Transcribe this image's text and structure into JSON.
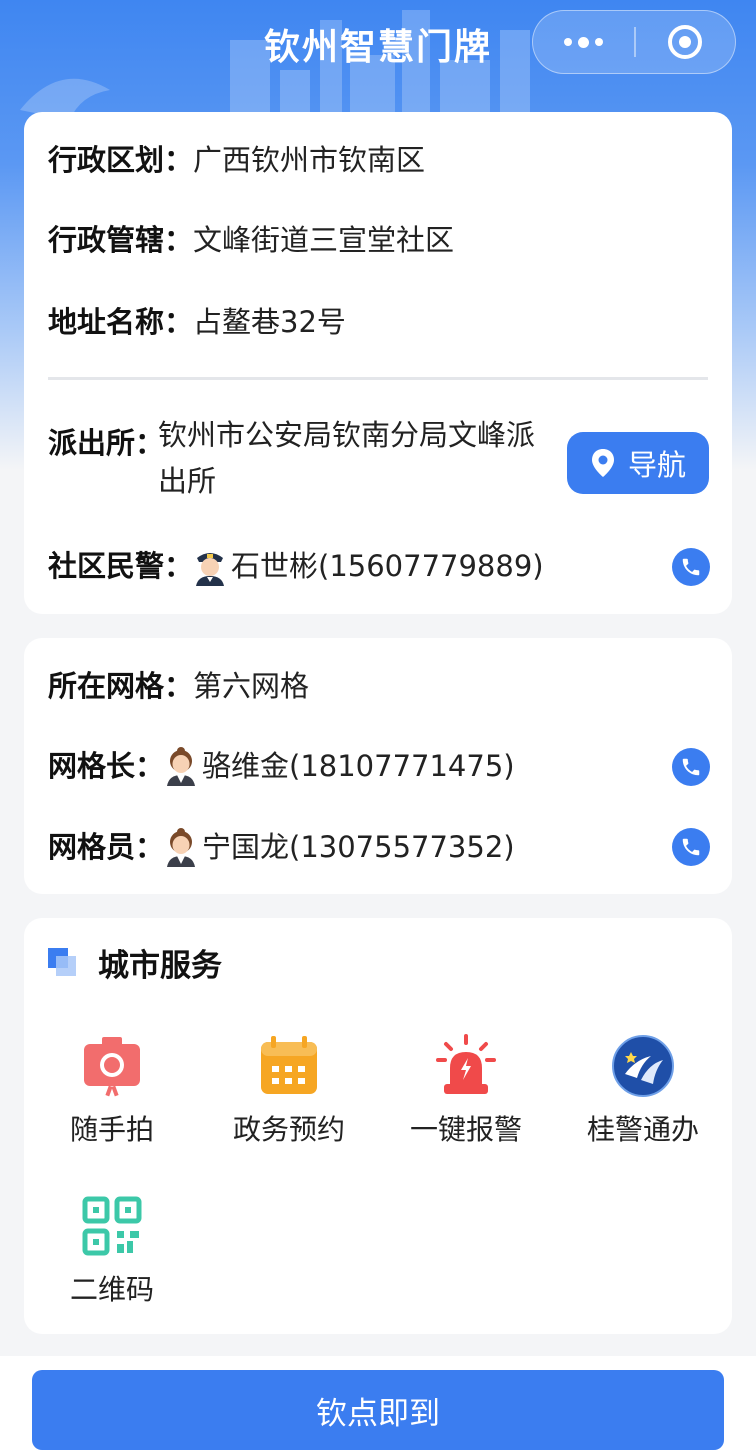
{
  "header": {
    "title": "钦州智慧门牌"
  },
  "info": {
    "division_label": "行政区划：",
    "division_value": "广西钦州市钦南区",
    "jurisdiction_label": "行政管辖：",
    "jurisdiction_value": "文峰街道三宣堂社区",
    "address_label": "地址名称：",
    "address_value": "占鳌巷32号",
    "station_label": "派出所：",
    "station_value": "钦州市公安局钦南分局文峰派出所",
    "nav_label": "导航",
    "police_label": "社区民警：",
    "police_value": "石世彬(15607779889)"
  },
  "grid": {
    "grid_label": "所在网格：",
    "grid_value": "第六网格",
    "leader_label": "网格长：",
    "leader_value": "骆维金(18107771475)",
    "member_label": "网格员：",
    "member_value": "宁国龙(13075577352)"
  },
  "services": {
    "title": "城市服务",
    "items": [
      {
        "label": "随手拍",
        "icon": "camera-icon",
        "color": "#f26d6d"
      },
      {
        "label": "政务预约",
        "icon": "calendar-icon",
        "color": "#f6a623"
      },
      {
        "label": "一键报警",
        "icon": "alarm-icon",
        "color": "#f04a4a"
      },
      {
        "label": "桂警通办",
        "icon": "guijing-logo-icon",
        "color": "#1f4fa8"
      },
      {
        "label": "二维码",
        "icon": "qrcode-icon",
        "color": "#3cc8a8"
      }
    ]
  },
  "footer": {
    "checkin_label": "钦点即到"
  },
  "colors": {
    "accent": "#3b7df0",
    "page_bg": "#f4f5f7"
  }
}
